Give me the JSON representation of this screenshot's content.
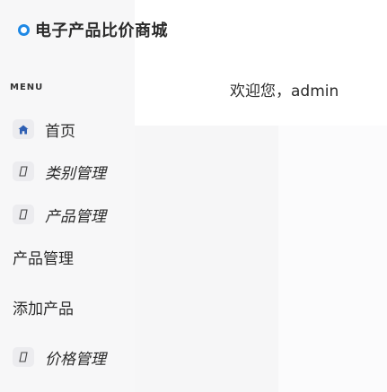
{
  "brand": {
    "title": "电子产品比价商城",
    "icon": "circle-logo-icon",
    "accent": "#1e88e5"
  },
  "sidebar": {
    "menu_heading": "MENU",
    "items": [
      {
        "label": "首页",
        "icon": "home-icon"
      },
      {
        "label": "类别管理",
        "icon": "placeholder-glyph-icon"
      },
      {
        "label": "产品管理",
        "icon": "placeholder-glyph-icon"
      },
      {
        "label": "价格管理",
        "icon": "placeholder-glyph-icon"
      }
    ],
    "sub_items": [
      {
        "label": "产品管理"
      },
      {
        "label": "添加产品"
      }
    ]
  },
  "header": {
    "welcome_prefix": "欢迎您，",
    "username": "admin"
  }
}
